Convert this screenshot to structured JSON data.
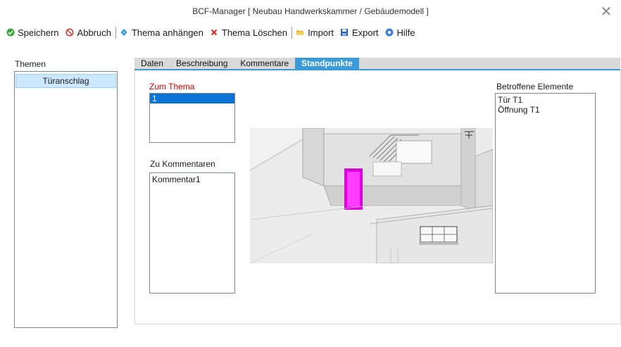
{
  "window": {
    "title": "BCF-Manager [ Neubau Handwerkskammer /  Gebäudemodell ]",
    "close_icon": "close-icon"
  },
  "toolbar": {
    "save_label": "Speichern",
    "cancel_label": "Abbruch",
    "attach_label": "Thema anhängen",
    "delete_label": "Thema Löschen",
    "import_label": "Import",
    "export_label": "Export",
    "help_label": "Hilfe"
  },
  "topics": {
    "label": "Themen",
    "items": [
      "Türanschlag"
    ]
  },
  "tabs": [
    {
      "label": "Daten",
      "active": false
    },
    {
      "label": "Beschreibung",
      "active": false
    },
    {
      "label": "Kommentare",
      "active": false
    },
    {
      "label": "Standpunkte",
      "active": true
    }
  ],
  "viewpoints": {
    "topic_label": "Zum Thema",
    "topic_items": [
      "1"
    ],
    "comments_label": "Zu Kommentaren",
    "comment_items": [
      "Kommentar1"
    ],
    "elements_label": "Betroffene Elemente",
    "element_items": [
      "Tür T1",
      "Öffnung T1"
    ]
  },
  "colors": {
    "accent": "#3c9bd6",
    "selection": "#0a74d4",
    "topic_selection": "#cce8ff",
    "red_label": "#c00000",
    "door_highlight": "#e000e0"
  }
}
